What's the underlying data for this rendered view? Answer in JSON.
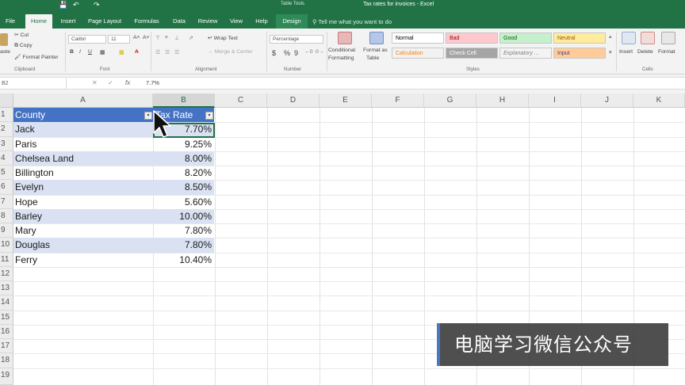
{
  "title_bar": {
    "context_label": "Table Tools",
    "document_title": "Tax rates for invoices  -  Excel"
  },
  "tabs": [
    {
      "label": "File"
    },
    {
      "label": "Home"
    },
    {
      "label": "Insert"
    },
    {
      "label": "Page Layout"
    },
    {
      "label": "Formulas"
    },
    {
      "label": "Data"
    },
    {
      "label": "Review"
    },
    {
      "label": "View"
    },
    {
      "label": "Help"
    },
    {
      "label": "Design"
    }
  ],
  "tell_me": "Tell me what you want to do",
  "ribbon": {
    "clipboard": {
      "cut": "Cut",
      "copy": "Copy",
      "paste": "aste",
      "format_painter": "Format Painter",
      "group": "Clipboard"
    },
    "font": {
      "family": "Calibri",
      "size": "11",
      "group": "Font"
    },
    "alignment": {
      "wrap_text": "Wrap Text",
      "merge_center": "Merge & Center",
      "group": "Alignment"
    },
    "number": {
      "format": "Percentage",
      "currency": "$",
      "percent": "%",
      "comma": "9",
      "group": "Number"
    },
    "styles": {
      "conditional": "Conditional",
      "conditional2": "Formatting",
      "format_as": "Format as",
      "format_as2": "Table",
      "cells": [
        {
          "label": "Normal",
          "bg": "#ffffff",
          "fg": "#000000"
        },
        {
          "label": "Bad",
          "bg": "#ffc7ce",
          "fg": "#9c0006"
        },
        {
          "label": "Good",
          "bg": "#c6efce",
          "fg": "#006100"
        },
        {
          "label": "Neutral",
          "bg": "#ffeb9c",
          "fg": "#9c5700"
        },
        {
          "label": "Calculation",
          "bg": "#f2f2f2",
          "fg": "#fa7d00"
        },
        {
          "label": "Check Cell",
          "bg": "#a5a5a5",
          "fg": "#ffffff"
        },
        {
          "label": "Explanatory ...",
          "bg": "#f3f3f3",
          "fg": "#7f7f7f"
        },
        {
          "label": "Input",
          "bg": "#ffcc99",
          "fg": "#3f3f76"
        }
      ],
      "group": "Styles"
    },
    "cells": {
      "insert": "Insert",
      "delete": "Delete",
      "format": "Format",
      "group": "Cells"
    }
  },
  "formula_bar": {
    "name_box": "B2",
    "cancel": "✕",
    "enter": "✓",
    "fx": "fx",
    "value": "7.7%"
  },
  "columns": [
    "A",
    "B",
    "C",
    "D",
    "E",
    "F",
    "G",
    "H",
    "I",
    "J",
    "K"
  ],
  "rows": [
    "1",
    "2",
    "3",
    "4",
    "5",
    "6",
    "7",
    "8",
    "9",
    "10",
    "11",
    "12",
    "13",
    "14",
    "15",
    "16",
    "17",
    "18",
    "19"
  ],
  "table": {
    "headers": [
      "County",
      "Tax Rate"
    ],
    "rows": [
      [
        "Jack",
        "7.70%"
      ],
      [
        "Paris",
        "9.25%"
      ],
      [
        "Chelsea Land",
        "8.00%"
      ],
      [
        "Billington",
        "8.20%"
      ],
      [
        "Evelyn",
        "8.50%"
      ],
      [
        "Hope",
        "5.60%"
      ],
      [
        "Barley",
        "10.00%"
      ],
      [
        "Mary",
        "7.80%"
      ],
      [
        "Douglas",
        "7.80%"
      ],
      [
        "Ferry",
        "10.40%"
      ]
    ],
    "header_color": "#4472c4",
    "band_color": "#d9e1f2"
  },
  "watermark": "电脑学习微信公众号"
}
